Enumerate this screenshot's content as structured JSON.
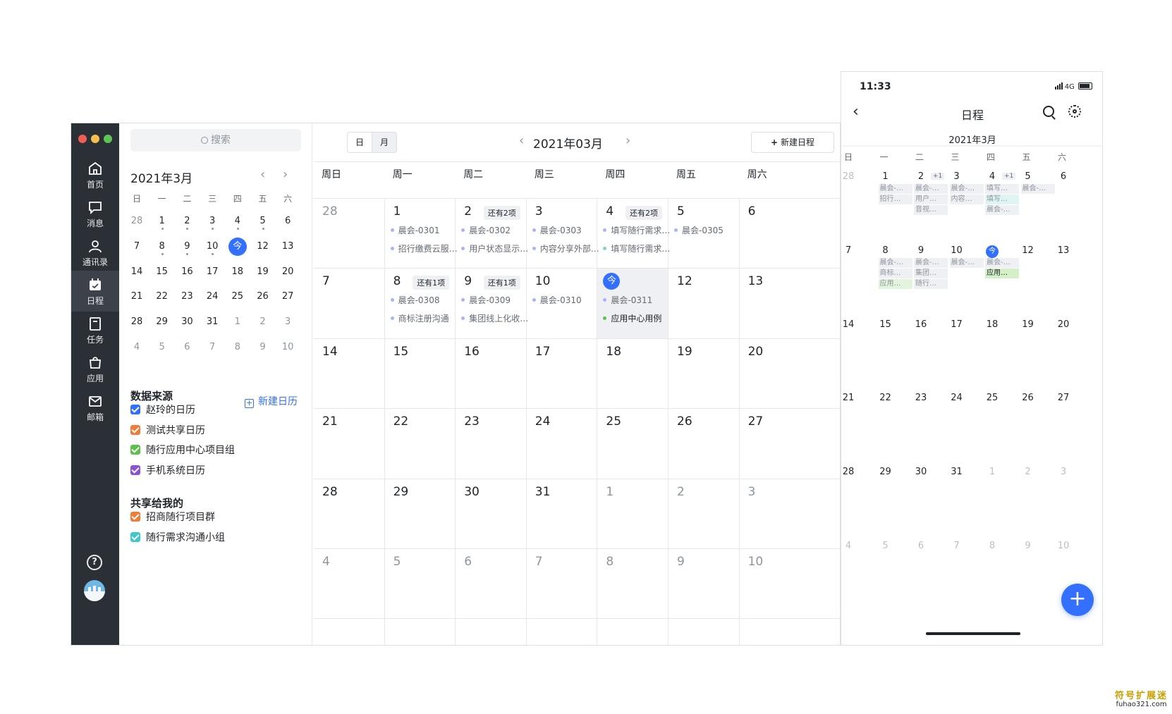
{
  "desktop": {
    "nav": [
      {
        "label": "首页",
        "icon": "home-icon"
      },
      {
        "label": "消息",
        "icon": "message-icon"
      },
      {
        "label": "通讯录",
        "icon": "contacts-icon"
      },
      {
        "label": "日程",
        "icon": "calendar-icon",
        "active": true
      },
      {
        "label": "任务",
        "icon": "task-icon"
      },
      {
        "label": "应用",
        "icon": "apps-icon"
      },
      {
        "label": "邮箱",
        "icon": "mail-icon"
      }
    ],
    "search_placeholder": "搜索",
    "mini_calendar": {
      "title": "2021年3月",
      "weekdays": [
        "日",
        "一",
        "二",
        "三",
        "四",
        "五",
        "六"
      ],
      "today_label": "今",
      "weeks": [
        [
          "28",
          "1",
          "2",
          "3",
          "4",
          "5",
          "6"
        ],
        [
          "7",
          "8",
          "9",
          "10",
          "今",
          "12",
          "13"
        ],
        [
          "14",
          "15",
          "16",
          "17",
          "18",
          "19",
          "20"
        ],
        [
          "21",
          "22",
          "23",
          "24",
          "25",
          "26",
          "27"
        ],
        [
          "28",
          "29",
          "30",
          "31",
          "1",
          "2",
          "3"
        ],
        [
          "4",
          "5",
          "6",
          "7",
          "8",
          "9",
          "10"
        ]
      ]
    },
    "data_sources": {
      "title": "数据来源",
      "new_calendar": "新建日历",
      "items": [
        {
          "label": "赵玲的日历",
          "color": "#3370ff"
        },
        {
          "label": "测试共享日历",
          "color": "#f07c37"
        },
        {
          "label": "随行应用中心项目组",
          "color": "#5bc24a"
        },
        {
          "label": "手机系统日历",
          "color": "#8b52d6"
        }
      ]
    },
    "shared": {
      "title": "共享给我的",
      "items": [
        {
          "label": "招商随行项目群",
          "color": "#f07c37"
        },
        {
          "label": "随行需求沟通小组",
          "color": "#3ec9c9"
        }
      ]
    },
    "toolbar": {
      "view_day": "日",
      "view_month": "月",
      "month_label": "2021年03月",
      "new_event": "新建日程"
    },
    "weekdays": [
      "周日",
      "周一",
      "周二",
      "周三",
      "周四",
      "周五",
      "周六"
    ],
    "weeks": [
      [
        {
          "day": "28",
          "dim": true
        },
        {
          "day": "1",
          "events": [
            {
              "t": "晨会-0301",
              "c": "#a9b4f5"
            },
            {
              "t": "招行缴费云服…",
              "c": "#a9b4f5"
            }
          ]
        },
        {
          "day": "2",
          "more": "还有2项",
          "events": [
            {
              "t": "晨会-0302",
              "c": "#a9b4f5"
            },
            {
              "t": "用户状态显示…",
              "c": "#a9b4f5"
            }
          ]
        },
        {
          "day": "3",
          "events": [
            {
              "t": "晨会-0303",
              "c": "#a9b4f5"
            },
            {
              "t": "内容分享外部…",
              "c": "#a9b4f5"
            }
          ]
        },
        {
          "day": "4",
          "more": "还有2项",
          "events": [
            {
              "t": "填写随行需求…",
              "c": "#a9b4f5"
            },
            {
              "t": "填写随行需求…",
              "c": "#7fd6d0"
            }
          ]
        },
        {
          "day": "5",
          "events": [
            {
              "t": "晨会-0305",
              "c": "#a9b4f5"
            }
          ]
        },
        {
          "day": "6"
        }
      ],
      [
        {
          "day": "7"
        },
        {
          "day": "8",
          "more": "还有1项",
          "events": [
            {
              "t": "晨会-0308",
              "c": "#a9b4f5"
            },
            {
              "t": "商标注册沟通",
              "c": "#a9b4f5"
            }
          ]
        },
        {
          "day": "9",
          "more": "还有1项",
          "events": [
            {
              "t": "晨会-0309",
              "c": "#a9b4f5"
            },
            {
              "t": "集团线上化收…",
              "c": "#a9b4f5"
            }
          ]
        },
        {
          "day": "10",
          "events": [
            {
              "t": "晨会-0310",
              "c": "#a9b4f5"
            }
          ]
        },
        {
          "day": "今",
          "today": true,
          "selected": true,
          "events": [
            {
              "t": "晨会-0311",
              "c": "#a9b4f5"
            },
            {
              "t": "应用中心用例",
              "c": "#5bc24a",
              "strong": true
            }
          ]
        },
        {
          "day": "12"
        },
        {
          "day": "13"
        }
      ],
      [
        {
          "day": "14"
        },
        {
          "day": "15"
        },
        {
          "day": "16"
        },
        {
          "day": "17"
        },
        {
          "day": "18"
        },
        {
          "day": "19"
        },
        {
          "day": "20"
        }
      ],
      [
        {
          "day": "21"
        },
        {
          "day": "22"
        },
        {
          "day": "23"
        },
        {
          "day": "24"
        },
        {
          "day": "25"
        },
        {
          "day": "26"
        },
        {
          "day": "27"
        }
      ],
      [
        {
          "day": "28"
        },
        {
          "day": "29"
        },
        {
          "day": "30"
        },
        {
          "day": "31"
        },
        {
          "day": "1",
          "dim": true
        },
        {
          "day": "2",
          "dim": true
        },
        {
          "day": "3",
          "dim": true
        }
      ],
      [
        {
          "day": "4",
          "dim": true
        },
        {
          "day": "5",
          "dim": true
        },
        {
          "day": "6",
          "dim": true
        },
        {
          "day": "7",
          "dim": true
        },
        {
          "day": "8",
          "dim": true
        },
        {
          "day": "9",
          "dim": true
        },
        {
          "day": "10",
          "dim": true
        }
      ]
    ]
  },
  "phone": {
    "time": "11:33",
    "network": "4G",
    "title": "日程",
    "month": "2021年3月",
    "weekdays": [
      "日",
      "一",
      "二",
      "三",
      "四",
      "五",
      "六"
    ],
    "weeks": [
      [
        {
          "day": "28",
          "dim": true
        },
        {
          "day": "1",
          "events": [
            {
              "t": "晨会-…",
              "bg": "#eef0f3"
            },
            {
              "t": "招行…",
              "bg": "#eef0f3"
            }
          ]
        },
        {
          "day": "2",
          "plus": "+1",
          "events": [
            {
              "t": "晨会-…",
              "bg": "#eef0f3"
            },
            {
              "t": "用户…",
              "bg": "#eef0f3"
            },
            {
              "t": "音视…",
              "bg": "#eef0f3"
            }
          ]
        },
        {
          "day": "3",
          "events": [
            {
              "t": "晨会-…",
              "bg": "#eef0f3"
            },
            {
              "t": "内容…",
              "bg": "#eef0f3"
            }
          ]
        },
        {
          "day": "4",
          "plus": "+1",
          "events": [
            {
              "t": "填写…",
              "bg": "#eef0f3"
            },
            {
              "t": "填写…",
              "bg": "#dff5f3"
            },
            {
              "t": "晨会-…",
              "bg": "#eef0f3"
            }
          ]
        },
        {
          "day": "5",
          "events": [
            {
              "t": "晨会-…",
              "bg": "#eef0f3"
            }
          ]
        },
        {
          "day": "6"
        }
      ],
      [
        {
          "day": "7"
        },
        {
          "day": "8",
          "events": [
            {
              "t": "晨会-…",
              "bg": "#eef0f3"
            },
            {
              "t": "商标…",
              "bg": "#eef0f3"
            },
            {
              "t": "应用…",
              "bg": "#e3f4dd"
            }
          ]
        },
        {
          "day": "9",
          "events": [
            {
              "t": "晨会-…",
              "bg": "#eef0f3"
            },
            {
              "t": "集团…",
              "bg": "#eef0f3"
            },
            {
              "t": "随行…",
              "bg": "#eef0f3"
            }
          ]
        },
        {
          "day": "10",
          "events": [
            {
              "t": "晨会-…",
              "bg": "#eef0f3"
            }
          ]
        },
        {
          "day": "今",
          "today": true,
          "events": [
            {
              "t": "晨会-…",
              "bg": "#eef0f3"
            },
            {
              "t": "应用…",
              "bg": "#d4f0c6",
              "strong": true
            }
          ]
        },
        {
          "day": "12"
        },
        {
          "day": "13"
        }
      ],
      [
        {
          "day": "14"
        },
        {
          "day": "15"
        },
        {
          "day": "16"
        },
        {
          "day": "17"
        },
        {
          "day": "18"
        },
        {
          "day": "19"
        },
        {
          "day": "20"
        }
      ],
      [
        {
          "day": "21"
        },
        {
          "day": "22"
        },
        {
          "day": "23"
        },
        {
          "day": "24"
        },
        {
          "day": "25"
        },
        {
          "day": "26"
        },
        {
          "day": "27"
        }
      ],
      [
        {
          "day": "28"
        },
        {
          "day": "29"
        },
        {
          "day": "30"
        },
        {
          "day": "31"
        },
        {
          "day": "1",
          "dim": true
        },
        {
          "day": "2",
          "dim": true
        },
        {
          "day": "3",
          "dim": true
        }
      ],
      [
        {
          "day": "4",
          "dim": true
        },
        {
          "day": "5",
          "dim": true
        },
        {
          "day": "6",
          "dim": true
        },
        {
          "day": "7",
          "dim": true
        },
        {
          "day": "8",
          "dim": true
        },
        {
          "day": "9",
          "dim": true
        },
        {
          "day": "10",
          "dim": true
        }
      ]
    ],
    "fab": "+"
  },
  "watermark": {
    "line1": "符号扩展迷",
    "line2": "fuhao321.com"
  }
}
